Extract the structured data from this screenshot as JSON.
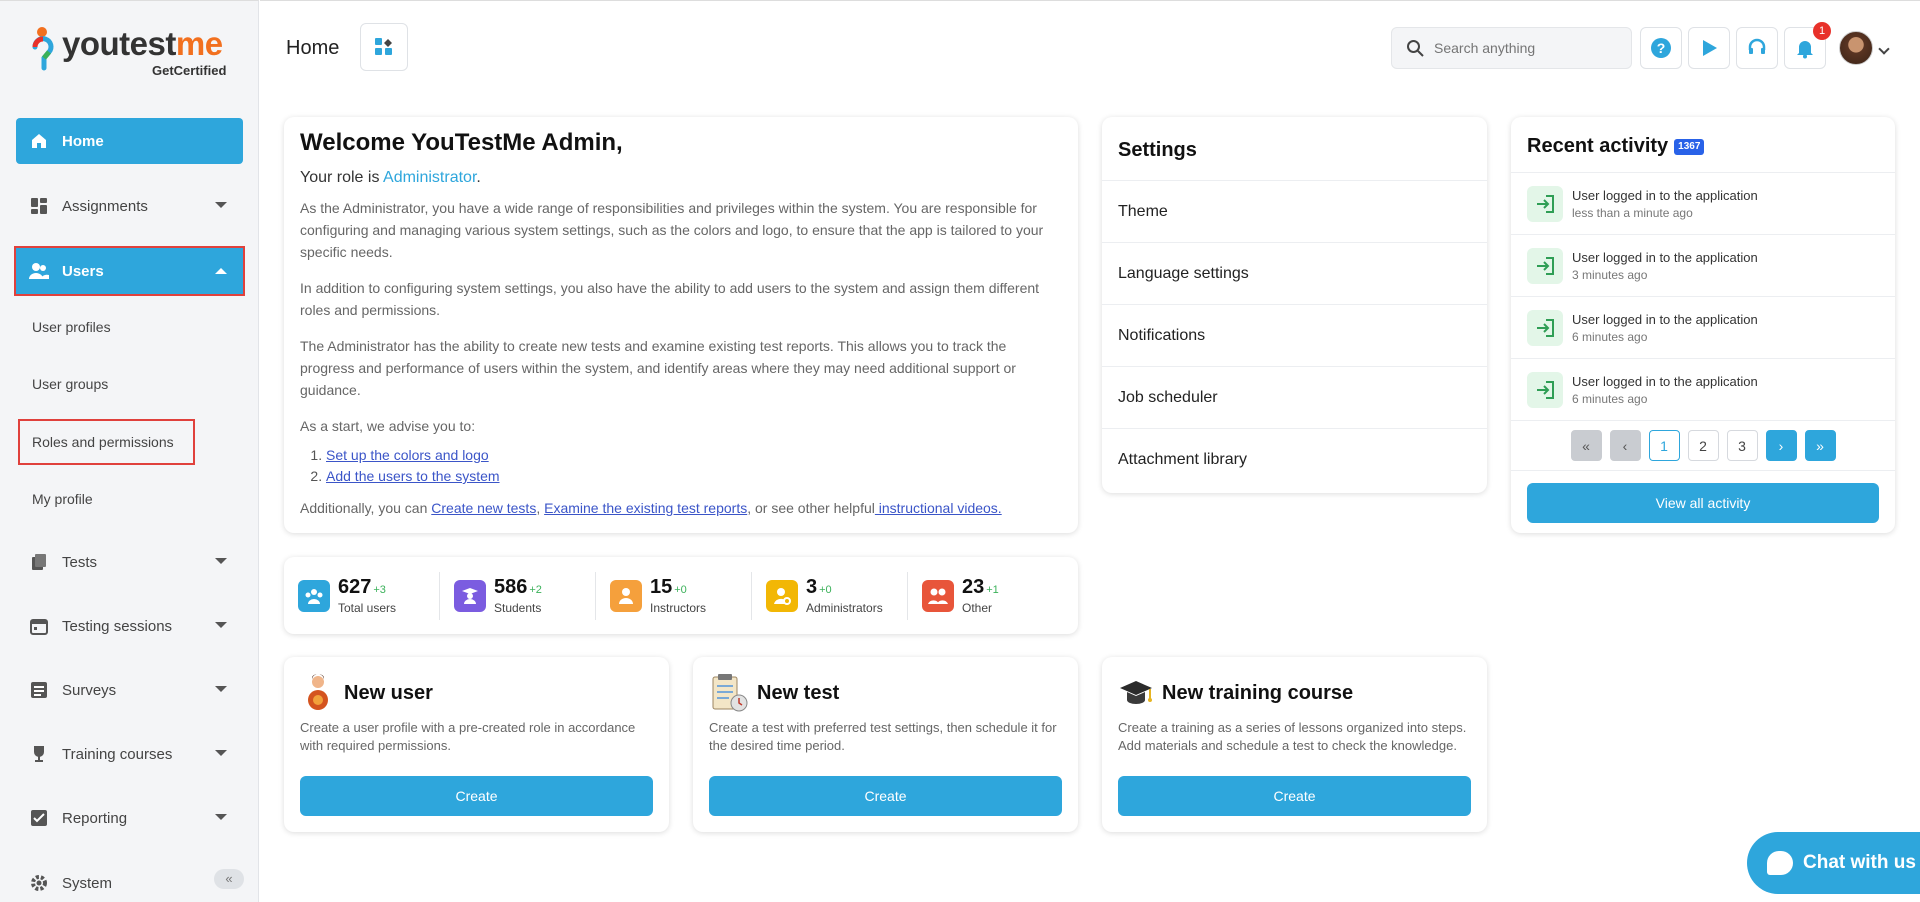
{
  "brand": {
    "name_part1": "youtest",
    "name_part2": "me",
    "tagline": "GetCertified"
  },
  "sidebar": {
    "items": [
      {
        "label": "Home"
      },
      {
        "label": "Assignments"
      },
      {
        "label": "Users"
      },
      {
        "label": "Tests"
      },
      {
        "label": "Testing sessions"
      },
      {
        "label": "Surveys"
      },
      {
        "label": "Training courses"
      },
      {
        "label": "Reporting"
      },
      {
        "label": "System"
      }
    ],
    "users_sub": [
      "User profiles",
      "User groups",
      "Roles and permissions",
      "My profile"
    ]
  },
  "header": {
    "title": "Home",
    "search_placeholder": "Search anything",
    "notification_count": "1"
  },
  "welcome": {
    "heading": "Welcome YouTestMe Admin,",
    "role_prefix": "Your role is ",
    "role": "Administrator",
    "role_suffix": ".",
    "p1": "As the Administrator, you have a wide range of responsibilities and privileges within the system. You are responsible for configuring and managing various system settings, such as the colors and logo, to ensure that the app is tailored to your specific needs.",
    "p2": "In addition to configuring system settings, you also have the ability to add users to the system and assign them different roles and permissions.",
    "p3": "The Administrator has the ability to create new tests and examine existing test reports. This allows you to track the progress and performance of users within the system, and identify areas where they may need additional support or guidance.",
    "p4": "As a start, we advise you to:",
    "steps": [
      "Set up the colors and logo",
      "Add the users to the system"
    ],
    "final_prefix": "Additionally, you can ",
    "final_link1": "Create new tests",
    "final_sep": ", ",
    "final_link2": "Examine the existing test reports",
    "final_mid": ", or see other helpful",
    "final_link3": " instructional videos."
  },
  "stats": [
    {
      "value": "627",
      "delta": "+3",
      "label": "Total users",
      "color": "#2ea6dc"
    },
    {
      "value": "586",
      "delta": "+2",
      "label": "Students",
      "color": "#7b5ce0"
    },
    {
      "value": "15",
      "delta": "+0",
      "label": "Instructors",
      "color": "#f5a03c"
    },
    {
      "value": "3",
      "delta": "+0",
      "label": "Administrators",
      "color": "#f2b705"
    },
    {
      "value": "23",
      "delta": "+1",
      "label": "Other",
      "color": "#e8553a"
    }
  ],
  "create_cards": [
    {
      "title": "New user",
      "desc": "Create a user profile with a pre-created role in accordance with required permissions.",
      "button": "Create"
    },
    {
      "title": "New test",
      "desc": "Create a test with preferred test settings, then schedule it for the desired time period.",
      "button": "Create"
    },
    {
      "title": "New training course",
      "desc": "Create a training as a series of lessons organized into steps. Add materials and schedule a test to check the knowledge.",
      "button": "Create"
    }
  ],
  "settings": {
    "title": "Settings",
    "items": [
      "Theme",
      "Language settings",
      "Notifications",
      "Job scheduler",
      "Attachment library"
    ]
  },
  "activity": {
    "title": "Recent activity",
    "count": "1367",
    "items": [
      {
        "text": "User logged in to the application",
        "time": "less than a minute ago"
      },
      {
        "text": "User logged in to the application",
        "time": "3 minutes ago"
      },
      {
        "text": "User logged in to the application",
        "time": "6 minutes ago"
      },
      {
        "text": "User logged in to the application",
        "time": "6 minutes ago"
      }
    ],
    "pages": [
      "1",
      "2",
      "3"
    ],
    "view_all": "View all activity"
  },
  "chat": {
    "label": "Chat with us"
  },
  "colors": {
    "accent": "#2ea6dc",
    "highlight_border": "#e0413c"
  }
}
